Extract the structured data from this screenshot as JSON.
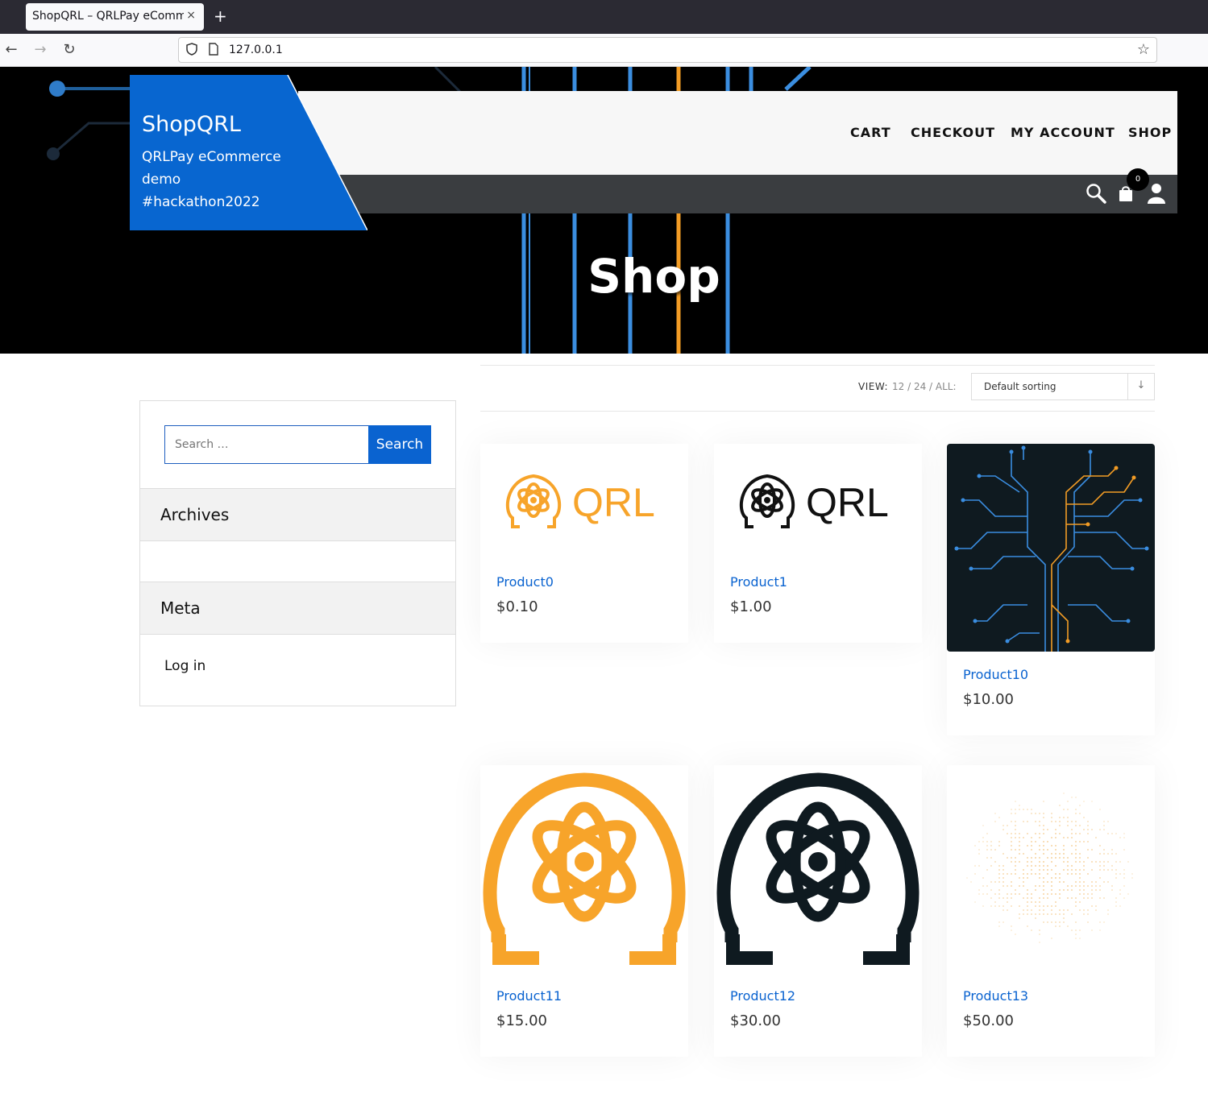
{
  "browser": {
    "tab_title": "ShopQRL – QRLPay eCommerce",
    "tab_close": "×",
    "new_tab": "+",
    "url": "127.0.0.1"
  },
  "site": {
    "title": "ShopQRL",
    "tagline": "QRLPay eCommerce demo #hackathon2022",
    "brand_color": "#0866d0"
  },
  "menu": {
    "items": [
      {
        "label": "CART"
      },
      {
        "label": "CHECKOUT"
      },
      {
        "label": "MY ACCOUNT"
      },
      {
        "label": "SHOP"
      }
    ]
  },
  "header_icons": {
    "search": "search-icon",
    "cart": "cart-bag-icon",
    "cart_count": "0",
    "user": "user-icon"
  },
  "page": {
    "title": "Shop"
  },
  "toolbar": {
    "view_label": "VIEW:",
    "view_options": "12 / 24 / ALL:",
    "sort_selected": "Default sorting"
  },
  "sidebar": {
    "search_placeholder": "Search …",
    "search_button": "Search",
    "archives_title": "Archives",
    "meta_title": "Meta",
    "login_link": "Log in"
  },
  "products": [
    {
      "name": "Product0",
      "price": "$0.10",
      "image": "qrl-logo-orange"
    },
    {
      "name": "Product1",
      "price": "$1.00",
      "image": "qrl-logo-black"
    },
    {
      "name": "Product10",
      "price": "$10.00",
      "image": "circuit-tree"
    },
    {
      "name": "Product11",
      "price": "$15.00",
      "image": "qrl-omega-orange"
    },
    {
      "name": "Product12",
      "price": "$30.00",
      "image": "qrl-omega-black"
    },
    {
      "name": "Product13",
      "price": "$50.00",
      "image": "dotted-pattern"
    }
  ],
  "colors": {
    "accent_blue": "#0a63d0",
    "qrl_orange": "#f7a42a",
    "qrl_dark": "#0f1a20"
  }
}
